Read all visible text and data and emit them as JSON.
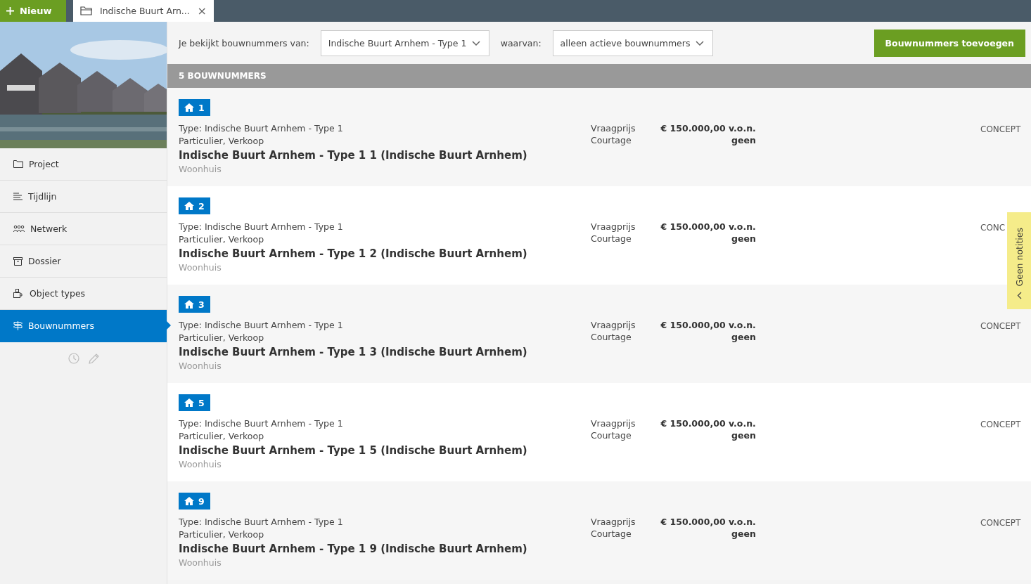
{
  "topbar": {
    "new_button": "Nieuw",
    "tabs": [
      {
        "label": "Indische Buurt Arn...",
        "selected": true,
        "close": "×"
      }
    ]
  },
  "sidebar": {
    "items": [
      {
        "label": "Project",
        "selected": false
      },
      {
        "label": "Tijdlijn",
        "selected": false
      },
      {
        "label": "Netwerk",
        "selected": false
      },
      {
        "label": "Dossier",
        "selected": false
      },
      {
        "label": "Object types",
        "selected": false
      },
      {
        "label": "Bouwnummers",
        "selected": true
      }
    ]
  },
  "filter": {
    "label": "Je bekijkt bouwnummers van:",
    "project_select": "Indische Buurt Arnhem - Type 1",
    "where_label": "waarvan:",
    "status_select": "alleen actieve bouwnummers",
    "add_button": "Bouwnummers toevoegen"
  },
  "list": {
    "heading": "5 BOUWNUMMERS",
    "rows": [
      {
        "number": "1",
        "type": "Type: Indische Buurt Arnhem - Type 1",
        "category": "Particulier, Verkoop",
        "title": "Indische Buurt Arnhem - Type 1 1 (Indische Buurt Arnhem)",
        "kind": "Woonhuis",
        "price_label": "Vraagprijs",
        "price": "€ 150.000,00 v.o.n.",
        "fee_label": "Courtage",
        "fee": "geen",
        "status": "CONCEPT"
      },
      {
        "number": "2",
        "type": "Type: Indische Buurt Arnhem - Type 1",
        "category": "Particulier, Verkoop",
        "title": "Indische Buurt Arnhem - Type 1 2 (Indische Buurt Arnhem)",
        "kind": "Woonhuis",
        "price_label": "Vraagprijs",
        "price": "€ 150.000,00 v.o.n.",
        "fee_label": "Courtage",
        "fee": "geen",
        "status": "CONC"
      },
      {
        "number": "3",
        "type": "Type: Indische Buurt Arnhem - Type 1",
        "category": "Particulier, Verkoop",
        "title": "Indische Buurt Arnhem - Type 1 3 (Indische Buurt Arnhem)",
        "kind": "Woonhuis",
        "price_label": "Vraagprijs",
        "price": "€ 150.000,00 v.o.n.",
        "fee_label": "Courtage",
        "fee": "geen",
        "status": "CONCEPT"
      },
      {
        "number": "5",
        "type": "Type: Indische Buurt Arnhem - Type 1",
        "category": "Particulier, Verkoop",
        "title": "Indische Buurt Arnhem - Type 1 5 (Indische Buurt Arnhem)",
        "kind": "Woonhuis",
        "price_label": "Vraagprijs",
        "price": "€ 150.000,00 v.o.n.",
        "fee_label": "Courtage",
        "fee": "geen",
        "status": "CONCEPT"
      },
      {
        "number": "9",
        "type": "Type: Indische Buurt Arnhem - Type 1",
        "category": "Particulier, Verkoop",
        "title": "Indische Buurt Arnhem - Type 1 9 (Indische Buurt Arnhem)",
        "kind": "Woonhuis",
        "price_label": "Vraagprijs",
        "price": "€ 150.000,00 v.o.n.",
        "fee_label": "Courtage",
        "fee": "geen",
        "status": "CONCEPT"
      }
    ]
  },
  "notes_tab": {
    "label": "Geen notities"
  }
}
